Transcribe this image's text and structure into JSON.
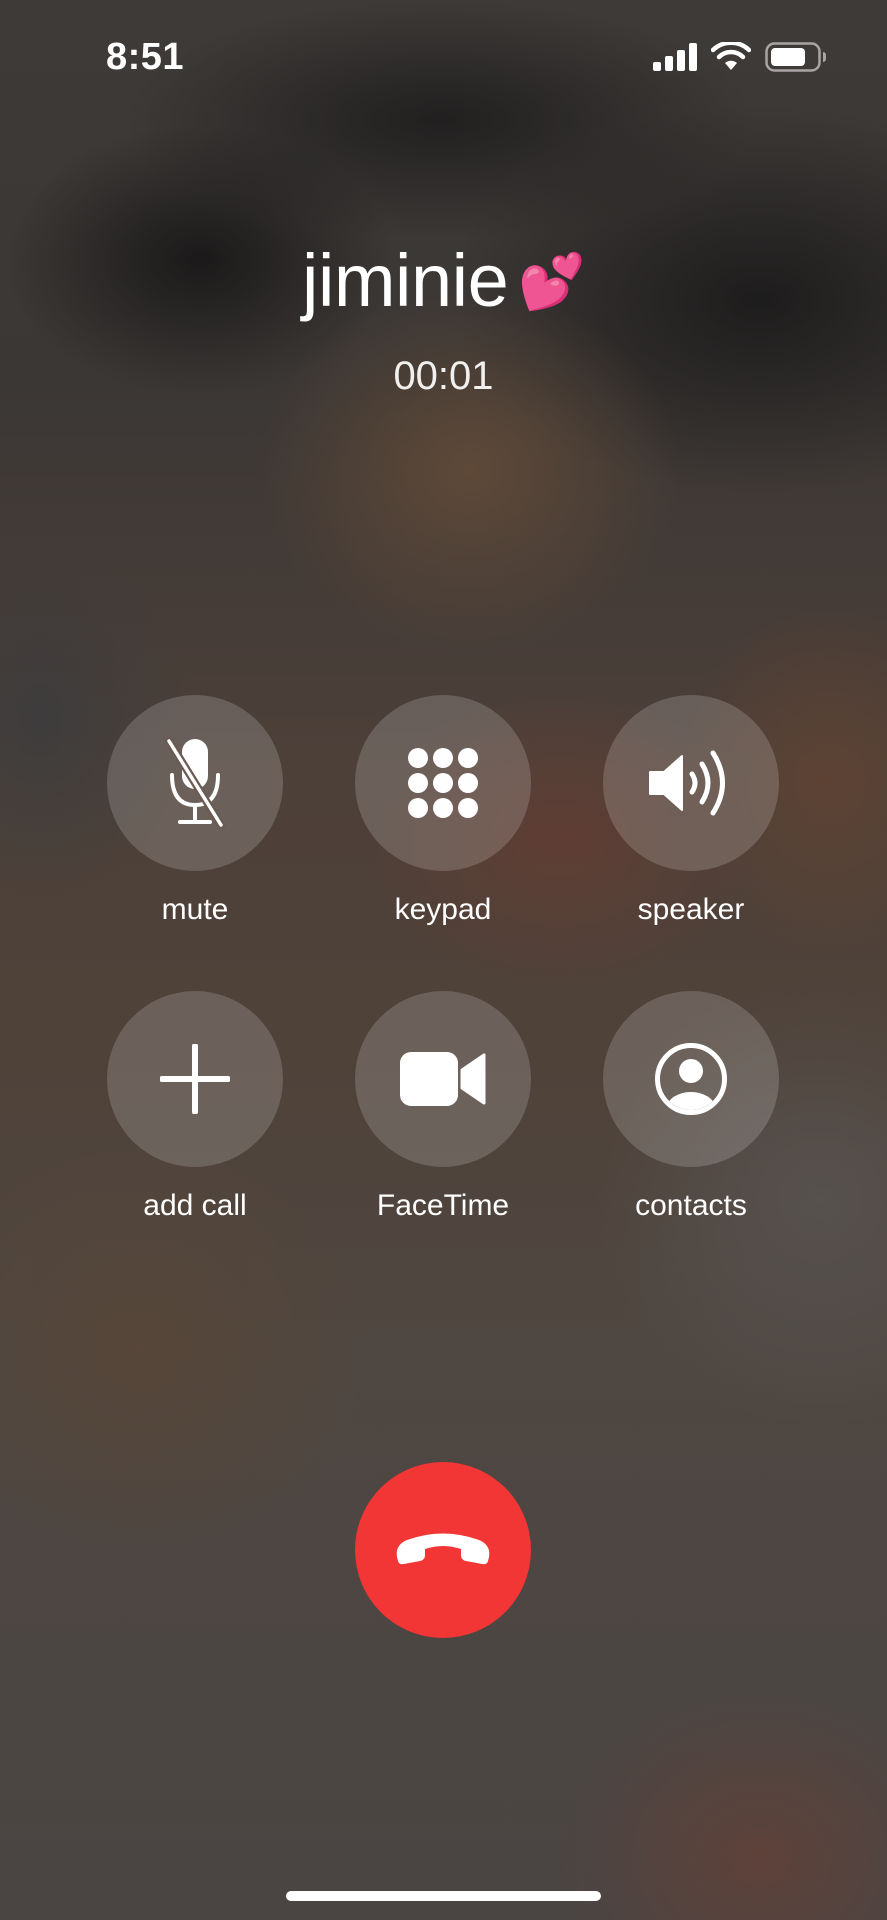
{
  "status_bar": {
    "time": "8:51",
    "icons": [
      "cellular-signal-icon",
      "wifi-icon",
      "battery-icon"
    ]
  },
  "call": {
    "caller_name": "jiminie",
    "caller_emoji": "💕",
    "duration": "00:01"
  },
  "controls": [
    {
      "label": "mute",
      "icon": "mic-slash-icon"
    },
    {
      "label": "keypad",
      "icon": "keypad-icon"
    },
    {
      "label": "speaker",
      "icon": "speaker-icon"
    },
    {
      "label": "add call",
      "icon": "plus-icon"
    },
    {
      "label": "FaceTime",
      "icon": "video-camera-icon"
    },
    {
      "label": "contacts",
      "icon": "person-circle-icon"
    }
  ],
  "end_call": {
    "icon": "phone-hangup-icon"
  },
  "colors": {
    "end_call": "#f23535",
    "button_fill": "rgba(255,255,255,0.17)",
    "text": "#ffffff"
  }
}
